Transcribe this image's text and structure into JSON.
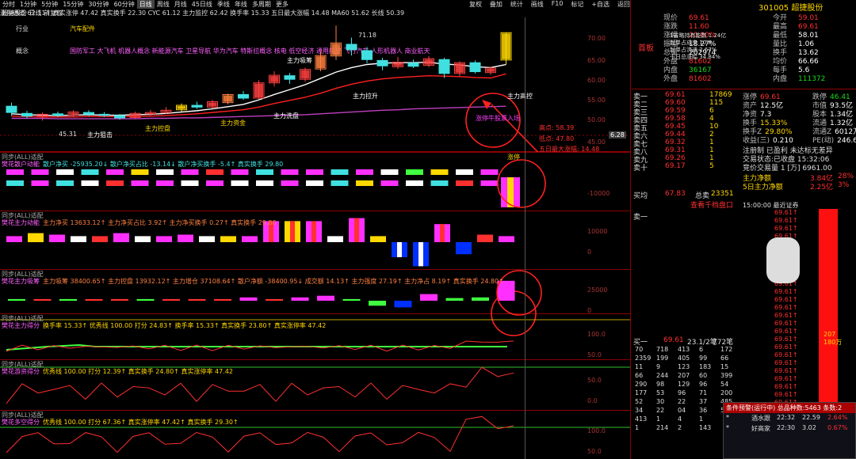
{
  "toolbar": {
    "items": [
      "分时",
      "1分钟",
      "5分钟",
      "15分钟",
      "30分钟",
      "60分钟",
      "日线",
      "周线",
      "月线",
      "45日线",
      "季线",
      "年线",
      "多周期",
      "更多"
    ],
    "active_index": 6,
    "right_items": [
      "复权",
      "叠加",
      "统计",
      "画线",
      "F10",
      "标记",
      "+自选",
      "返回"
    ]
  },
  "indicator_line": "涨停通道 62.11↑ 真实涨停 47.42 真实换手 22.30 CYC 61.12 主力监控 62.42 换手率 15.33 五日最大涨幅 14.48 MA60 51.62 长线 50.39",
  "stock_header": {
    "name_left": "超捷股份 日线 前复权",
    "tags": [
      "行业",
      "汽车配件"
    ],
    "concept_label": "概念",
    "concept_text": "国防军工 大飞机 机器人概念 新能源汽车 卫星导航 华为汽车 特斯拉概念 核电 低空经济 通用航空 飞行汽车 人形机器人 商业航天"
  },
  "main_chart": {
    "price_ticks": [
      "70.00",
      "65.00",
      "60.00",
      "55.00",
      "50.00",
      "45.00"
    ],
    "last_price": "6.28",
    "annotations": [
      {
        "text": "71.18",
        "color": "#ddd"
      },
      {
        "text": "45.31",
        "color": "#ddd"
      },
      {
        "text": "主力狙击",
        "color": "#fff"
      },
      {
        "text": "主力控盘",
        "color": "#ffd800"
      },
      {
        "text": "主力资金",
        "color": "#ffd800"
      },
      {
        "text": "主力洗盘",
        "color": "#fff"
      },
      {
        "text": "主力拉升",
        "color": "#fff"
      },
      {
        "text": "主力高控",
        "color": "#fff"
      },
      {
        "text": "主力吸筹",
        "color": "#fff"
      },
      {
        "text": "涨停牛股票入场",
        "color": "#ff40ff"
      }
    ],
    "info_box": [
      {
        "label": "高点",
        "value": "58.39"
      },
      {
        "label": "低点",
        "value": "47.80"
      },
      {
        "label": "五日最大涨幅",
        "value": "14.48"
      }
    ],
    "ohlc": [
      {
        "o": 53.2,
        "c": 51.8,
        "h": 54.0,
        "l": 51.0,
        "color": "#40e0e0"
      },
      {
        "o": 51.6,
        "c": 51.0,
        "h": 52.2,
        "l": 50.5,
        "color": "#40e0e0"
      },
      {
        "o": 51.0,
        "c": 51.4,
        "h": 51.8,
        "l": 50.0,
        "color": "#ff4040"
      },
      {
        "o": 51.5,
        "c": 51.2,
        "h": 52.0,
        "l": 50.8,
        "color": "#40e0e0"
      },
      {
        "o": 51.2,
        "c": 51.9,
        "h": 52.3,
        "l": 50.9,
        "color": "#ff4040"
      },
      {
        "o": 51.8,
        "c": 51.4,
        "h": 52.3,
        "l": 51.0,
        "color": "#40e0e0"
      },
      {
        "o": 51.4,
        "c": 51.2,
        "h": 51.9,
        "l": 50.8,
        "color": "#40e0e0"
      },
      {
        "o": 51.1,
        "c": 50.6,
        "h": 51.5,
        "l": 50.2,
        "color": "#40e0e0"
      },
      {
        "o": 50.7,
        "c": 51.6,
        "h": 52.0,
        "l": 50.4,
        "color": "#ff4040"
      },
      {
        "o": 51.5,
        "c": 51.8,
        "h": 52.4,
        "l": 51.1,
        "color": "#ff4040"
      },
      {
        "o": 51.8,
        "c": 52.3,
        "h": 53.0,
        "l": 51.4,
        "color": "#ff4040"
      },
      {
        "o": 52.4,
        "c": 53.4,
        "h": 53.8,
        "l": 52.0,
        "color": "#ffd800"
      },
      {
        "o": 53.4,
        "c": 53.0,
        "h": 54.2,
        "l": 52.6,
        "color": "#40e0e0"
      },
      {
        "o": 53.0,
        "c": 54.2,
        "h": 54.6,
        "l": 52.7,
        "color": "#ff4040"
      },
      {
        "o": 54.0,
        "c": 55.8,
        "h": 56.0,
        "l": 53.6,
        "color": "#ff8040"
      },
      {
        "o": 55.8,
        "c": 55.0,
        "h": 56.6,
        "l": 54.6,
        "color": "#40e0e0"
      },
      {
        "o": 55.0,
        "c": 58.4,
        "h": 59.0,
        "l": 54.8,
        "color": "#ff4040"
      },
      {
        "o": 58.4,
        "c": 60.1,
        "h": 61.0,
        "l": 57.6,
        "color": "#ff4040"
      },
      {
        "o": 60.0,
        "c": 59.2,
        "h": 60.6,
        "l": 58.2,
        "color": "#40e0e0"
      },
      {
        "o": 59.2,
        "c": 61.4,
        "h": 61.8,
        "l": 58.7,
        "color": "#ff4040"
      },
      {
        "o": 61.5,
        "c": 64.5,
        "h": 65.5,
        "l": 61.0,
        "color": "#ff8040"
      },
      {
        "o": 64.4,
        "c": 67.3,
        "h": 71.2,
        "l": 63.5,
        "color": "#ff8040"
      },
      {
        "o": 67.0,
        "c": 65.8,
        "h": 68.5,
        "l": 64.5,
        "color": "#40e0e0"
      },
      {
        "o": 65.6,
        "c": 63.6,
        "h": 66.4,
        "l": 62.8,
        "color": "#40e0e0"
      },
      {
        "o": 63.4,
        "c": 62.2,
        "h": 64.0,
        "l": 61.2,
        "color": "#40e0e0"
      },
      {
        "o": 62.0,
        "c": 63.0,
        "h": 64.2,
        "l": 61.5,
        "color": "#ff4040"
      },
      {
        "o": 62.8,
        "c": 62.1,
        "h": 63.6,
        "l": 61.7,
        "color": "#40e0e0"
      },
      {
        "o": 62.3,
        "c": 63.8,
        "h": 64.4,
        "l": 61.9,
        "color": "#ff4040"
      },
      {
        "o": 63.6,
        "c": 60.5,
        "h": 64.0,
        "l": 59.5,
        "color": "#40e0e0"
      },
      {
        "o": 60.5,
        "c": 62.9,
        "h": 63.2,
        "l": 59.8,
        "color": "#ff4040"
      },
      {
        "o": 62.9,
        "c": 60.9,
        "h": 63.4,
        "l": 60.5,
        "color": "#40e0e0"
      },
      {
        "o": 60.7,
        "c": 61.7,
        "h": 62.0,
        "l": 60.2,
        "color": "#ff4040"
      },
      {
        "o": 63.5,
        "c": 69.6,
        "h": 69.6,
        "l": 62.5,
        "color": "#ffd800"
      }
    ],
    "ma_white": [
      51.5,
      51.3,
      51.2,
      51.1,
      51.2,
      51.3,
      51.2,
      51.2,
      51.3,
      51.4,
      51.6,
      51.9,
      52.2,
      52.6,
      53.1,
      53.6,
      54.6,
      55.8,
      56.9,
      58.0,
      59.4,
      60.8,
      61.8,
      62.5,
      62.8,
      62.9,
      62.9,
      63.0,
      62.6,
      62.4,
      62.0,
      61.8,
      62.5
    ],
    "ma_red": [
      51.0,
      50.9,
      50.8,
      50.8,
      50.8,
      50.9,
      50.9,
      50.9,
      50.9,
      51.0,
      51.1,
      51.3,
      51.5,
      51.8,
      52.1,
      52.4,
      53.0,
      53.8,
      54.5,
      55.2,
      56.1,
      57.2,
      58.1,
      58.8,
      59.3,
      59.6,
      59.8,
      60.0,
      59.9,
      59.8,
      59.6,
      59.5,
      60.4
    ],
    "ma_magenta": [
      50.5,
      50.5,
      50.5,
      50.4,
      50.4,
      50.4,
      50.4,
      50.4,
      50.4,
      50.5,
      50.5,
      50.6,
      50.6,
      50.7,
      50.8,
      50.9,
      51.0,
      51.1,
      51.2,
      51.3,
      51.5,
      51.7,
      51.9,
      52.1,
      52.3,
      52.4,
      52.6,
      52.7,
      52.8,
      52.9,
      53.0,
      53.1,
      53.2
    ]
  },
  "panels": [
    {
      "title": "樊花散户动能",
      "fields": "散户净买 -25935.20↓ 散户净买占比 -13.14↓ 散户净买换手 -5.4↑ 真实换手 29.80",
      "title_color": "#ff60ff",
      "field_color": "#40e0e0",
      "right_ticks": [
        "",
        "-10000"
      ],
      "sig_label": "涨停",
      "mini_label": "同步(ALL)适配"
    },
    {
      "title": "樊花主力动能",
      "fields": "主力净买 13633.12↑ 主力净买占比 3.92↑ 主力净买换手 0.27↑ 真实换手 29.80",
      "title_color": "#ff60ff",
      "field_color": "#ff8040",
      "right_ticks": [
        "10000",
        "0"
      ],
      "mini_label": "同步(ALL)适配"
    },
    {
      "title": "樊花主力吸筹",
      "fields": "主力吸筹 38400.65↑ 主力控盘 13932.12↑ 主力增仓 37108.64↑ 散户净额 -38400.95↓ 成交额 14.13↑ 主力强度 27.19↑ 主力净占 8.19↑ 真实换手 24.80↑",
      "title_color": "#ff60ff",
      "field_color": "#ff8040",
      "right_ticks": [
        "25000",
        "0"
      ],
      "mini_label": "同步(ALL)适配"
    },
    {
      "title": "樊花主力得分",
      "fields": "换手率 15.33↑ 优秀线 100.00 打分 24.83↑ 换手率 15.33↑ 真实换手 23.80↑ 真实涨停率 47.42",
      "title_color": "#ff60ff",
      "field_color": "#ffd800",
      "right_ticks": [
        "100.0",
        "50.0"
      ],
      "mini_label": "同步(ALL)适配"
    },
    {
      "title": "樊花游资得分",
      "fields": "优秀线 100.00 打分 12.39↑ 真实换手 24.80↑ 真实涨停率 47.42",
      "title_color": "#ff60ff",
      "field_color": "#ffd800",
      "right_ticks": [
        "50.0",
        "0.0"
      ],
      "mini_label": "同步(ALL)适配"
    },
    {
      "title": "樊花多空得分",
      "fields": "优秀线 100.00 打分 67.36↑ 真实涨停率 47.42↑ 真实换手 29.30↑",
      "title_color": "#ff60ff",
      "field_color": "#ffd800",
      "right_ticks": [
        "100.0",
        "50.0"
      ],
      "mini_label": "同步(ALL)适配"
    }
  ],
  "panel1_bars": [
    {
      "colors": [
        "#ff30ff",
        "#40e0e0"
      ]
    },
    {
      "colors": [
        "#ff30ff",
        "#ff30ff"
      ]
    },
    {
      "colors": [
        "#fff",
        "#40e0e0"
      ]
    },
    {
      "colors": [
        "#40e0e0",
        "#fff"
      ]
    },
    {
      "colors": [
        "#ff30ff",
        "#ff3030"
      ]
    },
    {
      "colors": [
        "#ffd800",
        "#ff30ff"
      ]
    },
    {
      "colors": [
        "#fff",
        "#ff30ff"
      ]
    },
    {
      "colors": [
        "#ff30ff",
        "#fff"
      ]
    },
    {
      "colors": [
        "#ff3030",
        "#ff30ff"
      ]
    },
    {
      "colors": [
        "#ff30ff",
        "#fff"
      ]
    },
    {
      "colors": [
        "#40e0e0",
        "#fff"
      ]
    },
    {
      "colors": [
        "#ff30ff",
        "#ff30ff"
      ]
    },
    {
      "colors": [
        "#ff30ff",
        "#fff"
      ]
    },
    {
      "colors": [
        "#40e0e0",
        "#40e0e0"
      ]
    },
    {
      "colors": [
        "#ff30ff",
        "#ffd800"
      ]
    },
    {
      "colors": [
        "#fff",
        "#ff30ff"
      ]
    },
    {
      "colors": [
        "#40ff40",
        "#fff"
      ]
    },
    {
      "colors": [
        "#ffd800",
        "#40e0e0"
      ]
    },
    {
      "colors": [
        "#fff",
        "#ff3030"
      ]
    },
    {
      "colors": [
        "#ff30ff",
        "#ff30ff"
      ]
    }
  ],
  "panel2_bars": [
    {
      "v": 0.2
    },
    {
      "v": 0.3
    },
    {
      "v": 0.25
    },
    {
      "v": 0.2
    },
    {
      "v": 0.2
    },
    {
      "v": 0.3
    },
    {
      "v": 0.2
    },
    {
      "v": 0.2
    },
    {
      "v": 0.25
    },
    {
      "v": 0.2
    },
    {
      "v": 0.2
    },
    {
      "v": 0.2
    },
    {
      "v": 0.7
    },
    {
      "v": 0.7
    },
    {
      "v": 0.7
    },
    {
      "v": 0.2
    },
    {
      "v": 0.8
    },
    {
      "v": 0.2
    },
    {
      "v": -0.5
    },
    {
      "v": -0.8
    },
    {
      "v": 0.6
    },
    {
      "v": -0.4
    },
    {
      "v": 0.25
    },
    {
      "v": 0.2
    }
  ],
  "panel3_bars": [
    0.05,
    0.05,
    0.05,
    0.05,
    0.05,
    0.05,
    0.05,
    0.05,
    0.05,
    0.1,
    0.05,
    0.1,
    0.15,
    0.05,
    -0.15,
    -0.2,
    0.2,
    0.08,
    0.1,
    0.6
  ],
  "quote": {
    "code": "301005",
    "name": "超捷股份",
    "badge": "首板",
    "top_left": [
      {
        "k": "现价",
        "v": "69.61",
        "c": "red"
      },
      {
        "k": "涨跌",
        "v": "11.60",
        "c": "red"
      },
      {
        "k": "涨幅",
        "v": "20.00%",
        "c": "red"
      },
      {
        "k": "振幅",
        "v": "18.27%",
        "c": "wht"
      },
      {
        "k": "总量",
        "v": "202974",
        "c": "wht"
      },
      {
        "k": "外盘",
        "v": "81602",
        "c": "red"
      },
      {
        "k": "内盘",
        "v": "36167",
        "c": "grn"
      },
      {
        "k": "外盘",
        "v": "81602",
        "c": "red"
      }
    ],
    "top_right": [
      {
        "k": "今开",
        "v": "59.01",
        "c": "red"
      },
      {
        "k": "最高",
        "v": "69.61",
        "c": "red"
      },
      {
        "k": "最低",
        "v": "58.01",
        "c": "wht"
      },
      {
        "k": "量比",
        "v": "1.06",
        "c": "wht"
      },
      {
        "k": "换手",
        "v": "13.62",
        "c": "wht"
      },
      {
        "k": "均价",
        "v": "66.66",
        "c": "wht"
      },
      {
        "k": "每手",
        "v": "5.6",
        "c": "wht"
      },
      {
        "k": "内盘",
        "v": "111372",
        "c": "grn"
      }
    ],
    "mini_info": [
      "1省略持有能数  1.24亿",
      "封单占成交 10.8",
      "封单占流通  2.67%",
      "十日总涨幅  34.84%"
    ],
    "sell_book": [
      {
        "k": "卖一",
        "p": "69.61",
        "v": "17869",
        "c": "red"
      },
      {
        "k": "卖二",
        "p": "69.60",
        "v": "115",
        "c": "red"
      },
      {
        "k": "卖三",
        "p": "69.59",
        "v": "6",
        "c": "red"
      },
      {
        "k": "卖四",
        "p": "69.58",
        "v": "4",
        "c": "red"
      },
      {
        "k": "卖五",
        "p": "69.45",
        "v": "10",
        "c": "red"
      },
      {
        "k": "卖六",
        "p": "69.44",
        "v": "2",
        "c": "red"
      },
      {
        "k": "卖七",
        "p": "69.32",
        "v": "1",
        "c": "red"
      },
      {
        "k": "卖八",
        "p": "69.31",
        "v": "1",
        "c": "red"
      },
      {
        "k": "卖九",
        "p": "69.26",
        "v": "1",
        "c": "red"
      },
      {
        "k": "卖十",
        "p": "69.17",
        "v": "5",
        "c": "red"
      }
    ],
    "book_right": [
      {
        "k": "涨停",
        "v": "69.61",
        "c": "red"
      },
      {
        "k": "跌停",
        "v": "46.41",
        "c": "grn"
      },
      {
        "k": "资产",
        "v": "12.5亿",
        "c": "wht"
      },
      {
        "k": "市值",
        "v": "93.5亿",
        "c": "wht"
      },
      {
        "k": "净资",
        "v": "7.3",
        "c": "wht"
      },
      {
        "k": "股本",
        "v": "1.34亿",
        "c": "wht"
      },
      {
        "k": "换手",
        "v": "15.33%",
        "c": "yel"
      },
      {
        "k": "流通",
        "v": "1.32亿",
        "c": "wht"
      },
      {
        "k": "换手Z",
        "v": "29.80%",
        "c": "yel"
      },
      {
        "k": "流通Z",
        "v": "6012万",
        "c": "wht"
      },
      {
        "k": "收益(三)",
        "v": "0.210",
        "c": "wht"
      },
      {
        "k": "PE(动)",
        "v": "246.6",
        "c": "wht"
      }
    ],
    "limit_note": "注册制  已盈利  未达标无差异",
    "trade_state": "交易状态:已收盘 15:32:06",
    "auction": "竞价交易量 1 [万] 6961.00",
    "jme_lines": [
      {
        "label": "主力净额",
        "v1": "3.84亿",
        "v2": "28%"
      },
      {
        "label": "5日主力净额",
        "v1": "2.25亿",
        "v2": "3%"
      }
    ],
    "buy_label": "买均",
    "buy_avg": "67.83",
    "total_sell_label": "总卖",
    "total_sell": "23351",
    "buy_one_label": "卖一",
    "toast_label": "查看千档盘口",
    "time_strip": "15:00:00  最近证券",
    "ticks_list": [
      "69.61↑",
      "69.61↑",
      "69.61↑",
      "69.61↑",
      "69.61↑",
      "69.61↑",
      "69.61↑",
      "69.61↑",
      "69.61↑",
      "69.61↑",
      "69.61↑",
      "69.61↑",
      "69.61↑",
      "69.61↑",
      "69.61↑",
      "69.61↑",
      "69.61↑",
      "69.61↑",
      "69.61↑",
      "69.61↑",
      "69.61↑",
      "69.61↑",
      "69.61↑",
      "69.61↑",
      "69.61↑"
    ],
    "buy_header": [
      "买一",
      "69.61",
      "23.1/2笔",
      "772笔"
    ],
    "buy_queue": [
      [
        "70",
        "718",
        "413",
        "6",
        "172"
      ],
      [
        "2359",
        "199",
        "405",
        "99",
        "66"
      ],
      [
        "11",
        "9",
        "123",
        "183",
        "15"
      ],
      [
        "66",
        "244",
        "207",
        "60",
        "399"
      ],
      [
        "290",
        "98",
        "129",
        "96",
        "54"
      ],
      [
        "177",
        "53",
        "96",
        "71",
        "200"
      ],
      [
        "52",
        "30",
        "22",
        "37",
        "485"
      ],
      [
        "34",
        "22",
        "04",
        "36",
        "5"
      ],
      [
        "413",
        "1",
        "4",
        "1",
        ""
      ],
      [
        "1",
        "214",
        "2",
        "143",
        ""
      ]
    ],
    "side_stat": "207\n180万"
  },
  "popup": {
    "title": "条件预警(运行中) 总品种数:5463 条数:2",
    "rows": [
      [
        "*",
        "酒水跟",
        "22:32",
        "22.59",
        "2.64%"
      ],
      [
        "*",
        "好高家",
        "22:30",
        "3.02",
        "0.67%"
      ]
    ]
  }
}
